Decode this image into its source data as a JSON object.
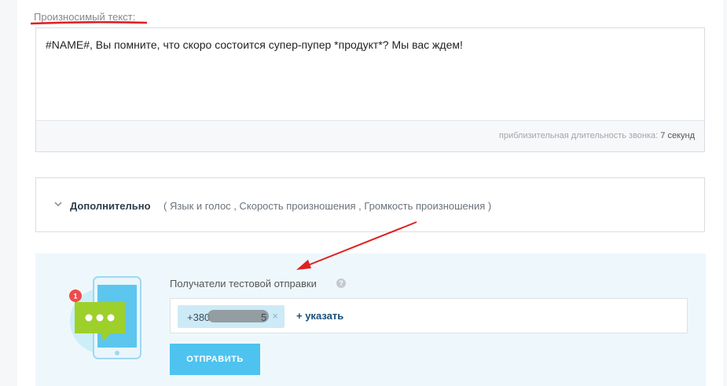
{
  "spoken_text": {
    "label": "Произносимый текст:",
    "value": "#NAME#, Вы помните, что скоро состоится супер-пупер *продукт*? Мы вас ждем!",
    "duration_prefix": "приблизительная длительность звонка: ",
    "duration_value": "7 секунд"
  },
  "additional": {
    "title": "Дополнительно",
    "options_text": "( Язык и голос ,  Скорость произношения ,  Громкость произношения  )"
  },
  "test_send": {
    "badge_count": "1",
    "recipients_label": "Получатели тестовой отправки",
    "help_glyph": "?",
    "chip_phone": "+380",
    "chip_phone_end": "5",
    "chip_remove": "×",
    "add_link": "+ указать",
    "send_button": "ОТПРАВИТЬ"
  },
  "colors": {
    "accent_blue": "#4ec3ef",
    "annotation_red": "#e02020",
    "panel_bg": "#eef8fc"
  }
}
